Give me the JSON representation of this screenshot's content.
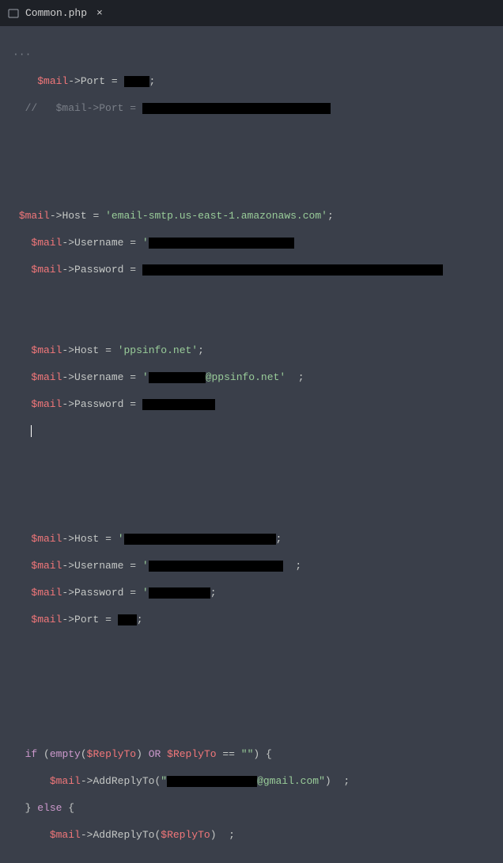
{
  "tab": {
    "name": "Common.php",
    "close_glyph": "×"
  },
  "code": {
    "mail": "$mail",
    "replyTo": "$ReplyTo",
    "arrow": "->",
    "eq": "=",
    "eqeq": "==",
    "semicolon": ";",
    "colon": ":",
    "squote": "'",
    "dquote": "\"",
    "Port": "Port",
    "Host": "Host",
    "Username": "Username",
    "Password": "Password",
    "AddReplyTo": "AddReplyTo",
    "commentPortLine": "//   $mail->Port = ",
    "host1": "'email-smtp.us-east-1.amazonaws.com'",
    "host2": "'ppsinfo.net'",
    "userAtPpsinfo": "@ppsinfo.net'",
    "gmailCom": "@gmail.com\"",
    "emptyStr": "\"\"",
    "kw_if": "if",
    "kw_else": "else",
    "kw_empty": "empty",
    "kw_OR": "OR",
    "lparen": "(",
    "rparen": ")",
    "lbrace": "{",
    "rbrace": "}"
  }
}
